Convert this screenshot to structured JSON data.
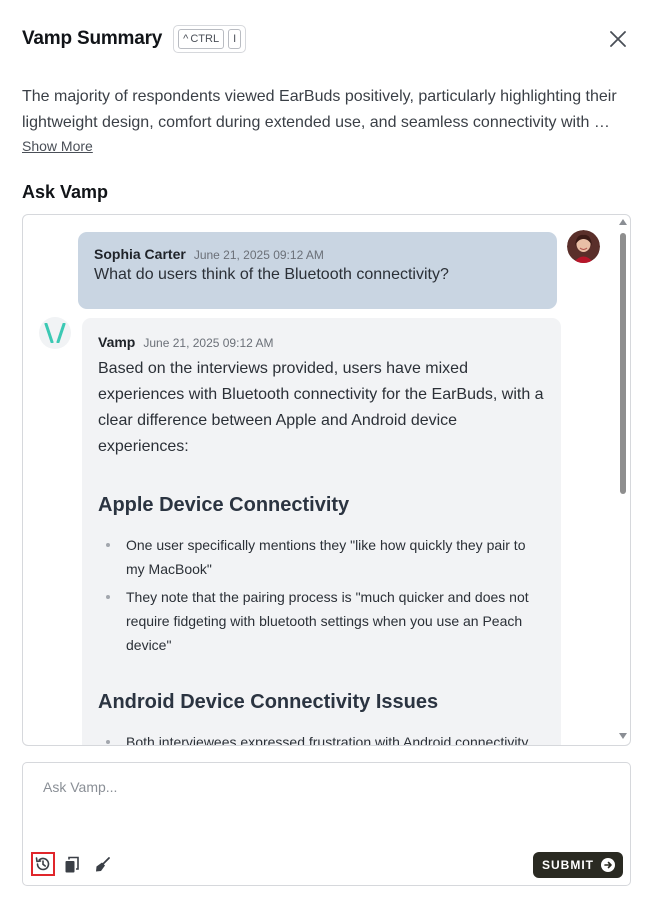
{
  "header": {
    "title": "Vamp Summary",
    "shortcut_key1": "CTRL",
    "shortcut_key1_prefix": "^",
    "shortcut_key2": "I"
  },
  "summary": {
    "text": "The majority of respondents viewed EarBuds positively, particularly highlighting their lightweight design, comfort during extended use, and seamless connectivity with …",
    "show_more_label": "Show More"
  },
  "ask": {
    "title": "Ask Vamp"
  },
  "messages": {
    "user": {
      "author": "Sophia Carter",
      "time": "June 21, 2025 09:12 AM",
      "text": "What do users think of the Bluetooth connectivity?"
    },
    "vamp": {
      "author": "Vamp",
      "time": "June 21, 2025 09:12 AM",
      "intro": "Based on the interviews provided, users have mixed experiences with Bluetooth connectivity for the EarBuds, with a clear difference between Apple and Android device experiences:",
      "section1_title": "Apple Device Connectivity",
      "section1_bullets": [
        "One user specifically mentions they \"like how quickly they pair to my MacBook\"",
        "They note that the pairing process is \"much quicker and does not require fidgeting with bluetooth settings when you use an Peach device\""
      ],
      "section2_title": "Android Device Connectivity Issues",
      "section2_bullets": [
        "Both interviewees expressed frustration with Android connectivity"
      ]
    }
  },
  "input": {
    "placeholder": "Ask Vamp...",
    "value": ""
  },
  "toolbar": {
    "submit_label": "SUBMIT"
  },
  "colors": {
    "user_bubble": "#c9d5e2",
    "vamp_bubble": "#f2f3f5",
    "submit_bg": "#2a2a22",
    "vamp_logo": "#3cc9b4",
    "history_highlight": "#e0262b"
  }
}
